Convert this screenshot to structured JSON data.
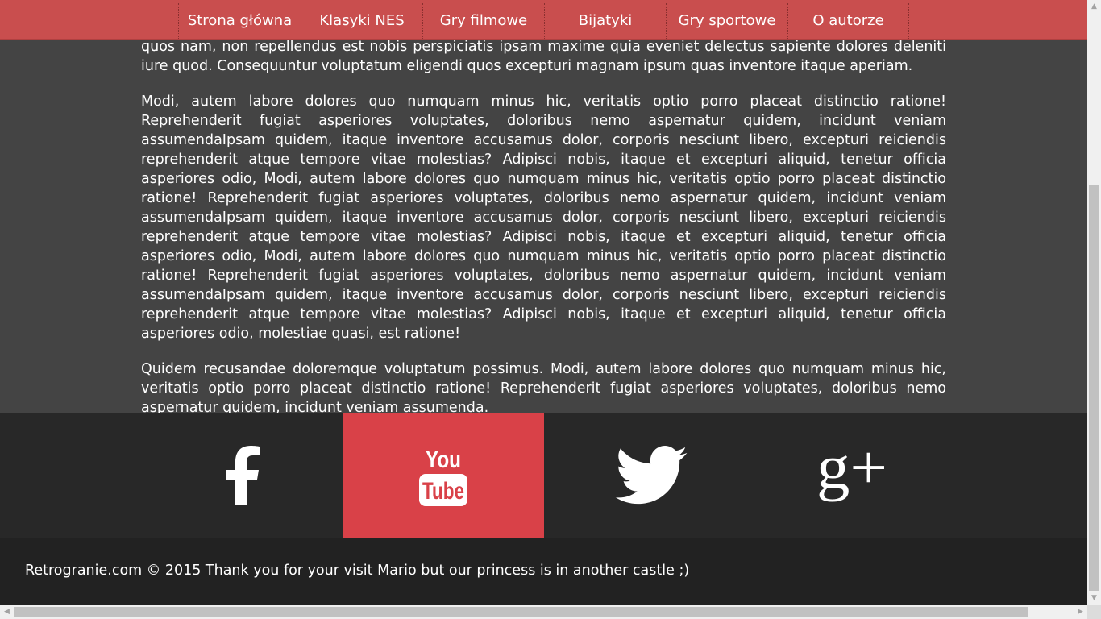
{
  "nav": {
    "items": [
      {
        "label": "Strona główna"
      },
      {
        "label": "Klasyki NES"
      },
      {
        "label": "Gry filmowe"
      },
      {
        "label": "Bijatyki"
      },
      {
        "label": "Gry sportowe"
      },
      {
        "label": "O autorze"
      }
    ]
  },
  "article": {
    "paragraphs": [
      "quos nam, non repellendus est nobis perspiciatis ipsam maxime quia eveniet delectus sapiente dolores deleniti iure quod. Consequuntur voluptatum eligendi quos excepturi magnam ipsum quas inventore itaque aperiam.",
      "Modi, autem labore dolores quo numquam minus hic, veritatis optio porro placeat distinctio ratione! Reprehenderit fugiat asperiores voluptates, doloribus nemo aspernatur quidem, incidunt veniam assumendaIpsam quidem, itaque inventore accusamus dolor, corporis nesciunt libero, excepturi reiciendis reprehenderit atque tempore vitae molestias? Adipisci nobis, itaque et excepturi aliquid, tenetur officia asperiores odio, Modi, autem labore dolores quo numquam minus hic, veritatis optio porro placeat distinctio ratione! Reprehenderit fugiat asperiores voluptates, doloribus nemo aspernatur quidem, incidunt veniam assumendaIpsam quidem, itaque inventore accusamus dolor, corporis nesciunt libero, excepturi reiciendis reprehenderit atque tempore vitae molestias? Adipisci nobis, itaque et excepturi aliquid, tenetur officia asperiores odio, Modi, autem labore dolores quo numquam minus hic, veritatis optio porro placeat distinctio ratione! Reprehenderit fugiat asperiores voluptates, doloribus nemo aspernatur quidem, incidunt veniam assumendaIpsam quidem, itaque inventore accusamus dolor, corporis nesciunt libero, excepturi reiciendis reprehenderit atque tempore vitae molestias? Adipisci nobis, itaque et excepturi aliquid, tenetur officia asperiores odio, molestiae quasi, est ratione!",
      "Quidem recusandae doloremque voluptatum possimus. Modi, autem labore dolores quo numquam minus hic, veritatis optio porro placeat distinctio ratione! Reprehenderit fugiat asperiores voluptates, doloribus nemo aspernatur quidem, incidunt veniam assumenda."
    ]
  },
  "social": {
    "items": [
      {
        "icon": "facebook-icon"
      },
      {
        "icon": "youtube-icon",
        "logo_top": "You",
        "logo_bottom": "Tube"
      },
      {
        "icon": "twitter-icon"
      },
      {
        "icon": "google-plus-icon",
        "glyph": "g+"
      }
    ]
  },
  "footer": {
    "text": "Retrogranie.com © 2015 Thank you for your visit Mario but our princess is in another castle ;)"
  },
  "colors": {
    "nav_bg": "#c94e4e",
    "content_bg": "#444444",
    "social_bg": "#282828",
    "youtube_active_bg": "#d94148",
    "footer_bg": "#222222"
  }
}
